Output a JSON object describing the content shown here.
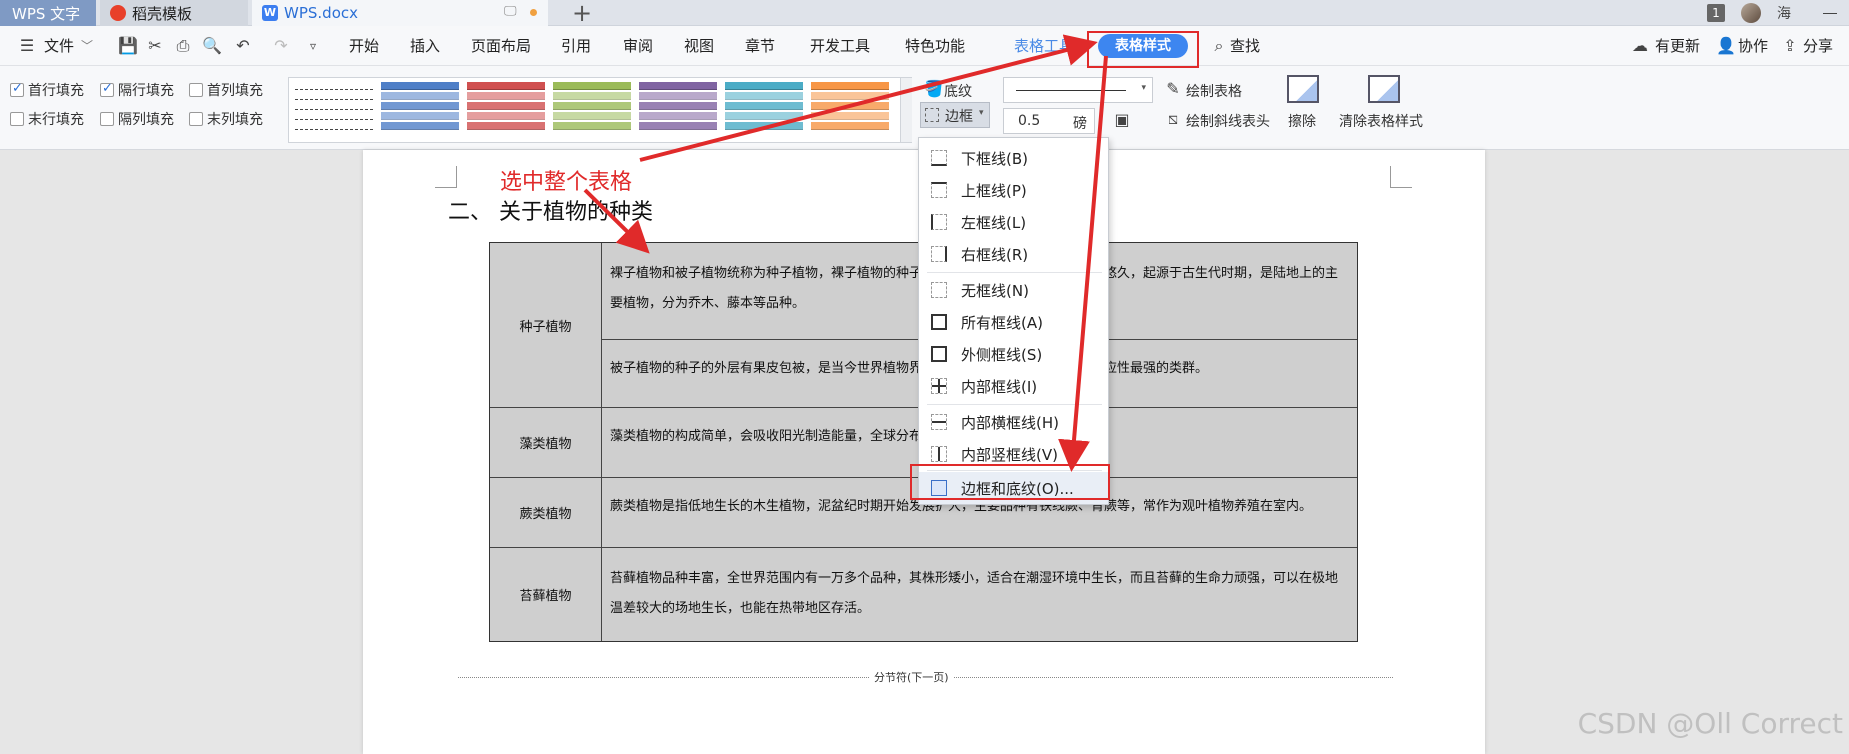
{
  "tabs": {
    "app": "WPS 文字",
    "template": "稻壳模板",
    "doc": "WPS.docx",
    "new_tab": "+",
    "page_count": "1",
    "user": "海"
  },
  "menu": {
    "file": "文件",
    "items": [
      "开始",
      "插入",
      "页面布局",
      "引用",
      "审阅",
      "视图",
      "章节",
      "开发工具",
      "特色功能"
    ],
    "table_tools": "表格工具",
    "table_style": "表格样式",
    "search": "查找",
    "update": "有更新",
    "collab": "协作",
    "share": "分享"
  },
  "ribbon": {
    "checks": [
      {
        "label": "首行填充",
        "checked": true
      },
      {
        "label": "隔行填充",
        "checked": true
      },
      {
        "label": "首列填充",
        "checked": false
      },
      {
        "label": "末行填充",
        "checked": false
      },
      {
        "label": "隔列填充",
        "checked": false
      },
      {
        "label": "末列填充",
        "checked": false
      }
    ],
    "shading": "底纹",
    "border": "边框",
    "line_width": "0.5",
    "line_unit": "磅",
    "draw_table": "绘制表格",
    "draw_diag": "绘制斜线表头",
    "erase": "擦除",
    "clear_style": "清除表格样式",
    "style_colors": [
      "#ffffff",
      "#4f7fc7",
      "#d05050",
      "#9bbb59",
      "#8064a2",
      "#4bacc6",
      "#f79646"
    ]
  },
  "document": {
    "heading": "二、 关于植物的种类",
    "rows": [
      {
        "label": "种子植物",
        "texts": [
          "裸子植物和被子植物统称为种子植物，裸子植物的种子裸露，没有果皮包被，发展历史悠久，起源于古生代时期，是陆地上的主要植物，分为乔木、藤本等品种。",
          "被子植物的种子的外层有果皮包被，是当今世界植物界中进化程度最高、分布最广、适应性最强的类群。"
        ]
      },
      {
        "label": "藻类植物",
        "texts": [
          "藻类植物的构成简单，会吸收阳光制造能量，全球分布广泛。"
        ]
      },
      {
        "label": "蕨类植物",
        "texts": [
          "蕨类植物是指低地生长的木生植物，泥盆纪时期开始发展扩大，主要品种有铁线蕨、肾蕨等，常作为观叶植物养殖在室内。"
        ]
      },
      {
        "label": "苔藓植物",
        "texts": [
          "苔藓植物品种丰富，全世界范围内有一万多个品种，其株形矮小，适合在潮湿环境中生长，而且苔藓的生命力顽强，可以在极地温差较大的场地生长，也能在热带地区存活。"
        ]
      }
    ],
    "section_break": "分节符(下一页)"
  },
  "border_menu": {
    "items": [
      "下框线(B)",
      "上框线(P)",
      "左框线(L)",
      "右框线(R)",
      "无框线(N)",
      "所有框线(A)",
      "外侧框线(S)",
      "内部框线(I)",
      "内部横框线(H)",
      "内部竖框线(V)",
      "边框和底纹(O)..."
    ]
  },
  "annotation": "选中整个表格",
  "watermark": "CSDN @Oll Correct",
  "colors": {
    "accent": "#3d86f0",
    "annotation_red": "#e02a2a"
  }
}
